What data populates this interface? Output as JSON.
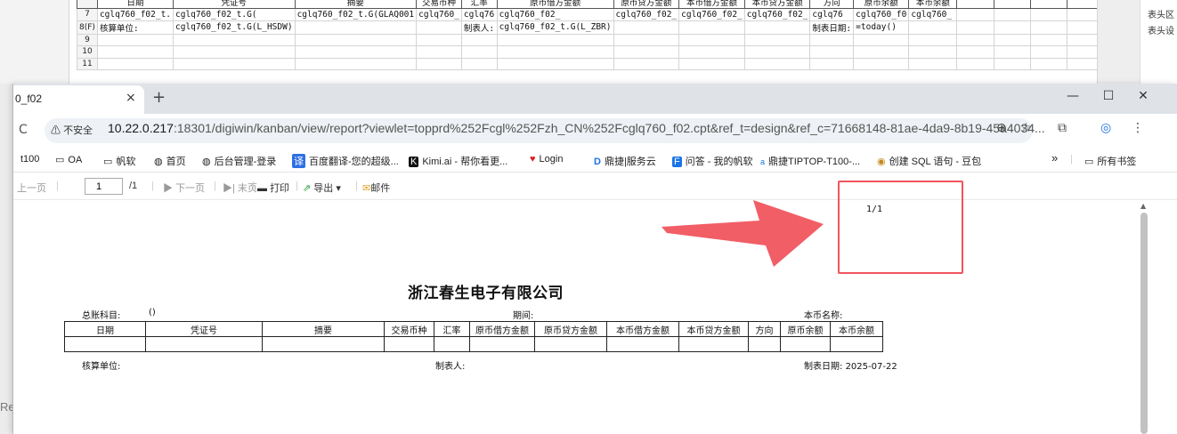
{
  "designer": {
    "rows": [
      {
        "num": "",
        "cells": [
          "日期",
          "凭证号",
          "摘要",
          "交易币种",
          "汇率",
          "原币借方金额",
          "原币贷方金额",
          "本币借方金额",
          "本币贷方金额",
          "方向",
          "原币余额",
          "本币余额",
          "",
          "",
          "",
          "",
          "",
          ""
        ]
      },
      {
        "num": "7",
        "cells": [
          "cglq760_f02_t.",
          "cglq760_f02_t.G(",
          "cglq760_f02_t.G(GLAQ001",
          "cglq760_",
          "cglq76",
          "cglq760_f02_",
          "cglq760_f02_",
          "cglq760_f02_",
          "cglq760_f02_",
          "cglq76",
          "cglq760_f0",
          "cglq760_",
          "",
          "",
          "",
          "",
          "",
          ""
        ]
      },
      {
        "num": "8(F)",
        "cells": [
          "核算单位:",
          "cglq760_f02_t.G(L_HSDW)",
          "",
          "",
          "制表人:",
          "cglq760_f02_t.G(L_ZBR)",
          "",
          "",
          "",
          "制表日期:",
          "=today()",
          "",
          "",
          "",
          "",
          "",
          "",
          ""
        ]
      },
      {
        "num": "9",
        "cells": [
          "",
          "",
          "",
          "",
          "",
          "",
          "",
          "",
          "",
          "",
          "",
          "",
          "",
          "",
          "",
          "",
          "",
          ""
        ]
      },
      {
        "num": "10",
        "cells": [
          "",
          "",
          "",
          "",
          "",
          "",
          "",
          "",
          "",
          "",
          "",
          "",
          "",
          "",
          "",
          "",
          "",
          ""
        ]
      },
      {
        "num": "11",
        "cells": [
          "",
          "",
          "",
          "",
          "",
          "",
          "",
          "",
          "",
          "",
          "",
          "",
          "",
          "",
          "",
          "",
          "",
          ""
        ]
      }
    ],
    "right_panel": [
      "表头区",
      "表头设"
    ]
  },
  "left_fragment": "Re",
  "browser": {
    "tab_title": "0_f02",
    "tab_close": "×",
    "new_tab": "+",
    "window_controls": [
      "—",
      "☐",
      "✕"
    ],
    "security_label": "不安全",
    "url_domain": "10.22.0.217",
    "url_path": ":18301/digiwin/kanban/view/report?viewlet=topprd%252Fcgl%252Fzh_CN%252Fcglq760_f02.cpt&ref_t=design&ref_c=71668148-81ae-4da9-8b19-45a4034...",
    "bookmarks": [
      {
        "icon": "",
        "label": "t100"
      },
      {
        "icon": "▭",
        "label": "OA"
      },
      {
        "icon": "▭",
        "label": "帆软"
      },
      {
        "icon": "◍",
        "label": "首页"
      },
      {
        "icon": "◍",
        "label": "后台管理-登录"
      },
      {
        "icon": "译",
        "label": "百度翻译-您的超级..."
      },
      {
        "icon": "K",
        "label": "Kimi.ai - 帮你看更..."
      },
      {
        "icon": "♥",
        "label": "Login"
      },
      {
        "icon": "D",
        "label": "鼎捷|服务云"
      },
      {
        "icon": "F",
        "label": "问答 - 我的帆软"
      },
      {
        "icon": "a",
        "label": "鼎捷TIPTOP-T100-..."
      },
      {
        "icon": "◉",
        "label": "创建 SQL 语句 - 豆包"
      }
    ],
    "bookmark_overflow": "»",
    "all_bookmarks": "所有书签"
  },
  "toolbar": {
    "prev": "上一页",
    "page_value": "1",
    "page_total": "/1",
    "next": "下一页",
    "last": "末页",
    "print": "打印",
    "export": "导出",
    "mail": "邮件"
  },
  "report": {
    "page_indicator": "1/1",
    "company": "浙江春生电子有限公司",
    "account_label": "总账科目:",
    "account_value": "()",
    "period_label": "期间:",
    "currency_label": "本币名称:",
    "headers": [
      "日期",
      "凭证号",
      "摘要",
      "交易币种",
      "汇率",
      "原币借方金额",
      "原币贷方金额",
      "本币借方金额",
      "本币贷方金额",
      "方向",
      "原币余额",
      "本币余额"
    ],
    "unit_label": "核算单位:",
    "maker_label": "制表人:",
    "date_label": "制表日期:",
    "date_value": "2025-07-22"
  },
  "colors": {
    "annotation": "#f0555e",
    "tabbar": "#dfe3e8"
  }
}
